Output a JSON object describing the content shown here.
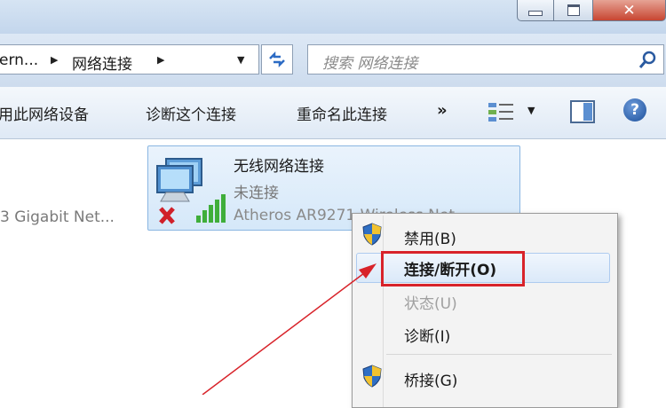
{
  "window": {
    "close_glyph": "✕"
  },
  "address_bar": {
    "crumbs": [
      "ern...",
      "网络连接"
    ],
    "search_placeholder": "搜索 网络连接"
  },
  "toolbar": {
    "item1": "用此网络设备",
    "item2": "诊断这个连接",
    "item3": "重命名此连接",
    "more": "»",
    "help": "?"
  },
  "content": {
    "left_item_text": "3 Gigabit Net...",
    "selected_adapter": {
      "name": "无线网络连接",
      "status": "未连接",
      "device": "Atheros AR9271 Wireless Net"
    }
  },
  "context_menu": {
    "items": [
      {
        "label": "禁用(B)",
        "shield": true,
        "disabled": false
      },
      {
        "label": "连接/断开(O)",
        "shield": false,
        "disabled": false,
        "highlighted": true
      },
      {
        "label": "状态(U)",
        "shield": false,
        "disabled": true
      },
      {
        "label": "诊断(I)",
        "shield": false,
        "disabled": false
      },
      {
        "label": "桥接(G)",
        "shield": true,
        "disabled": false
      }
    ]
  },
  "colors": {
    "annotation_red": "#d8232a",
    "selection_border": "#8ab6e2",
    "menu_background": "#f3f3f3"
  }
}
